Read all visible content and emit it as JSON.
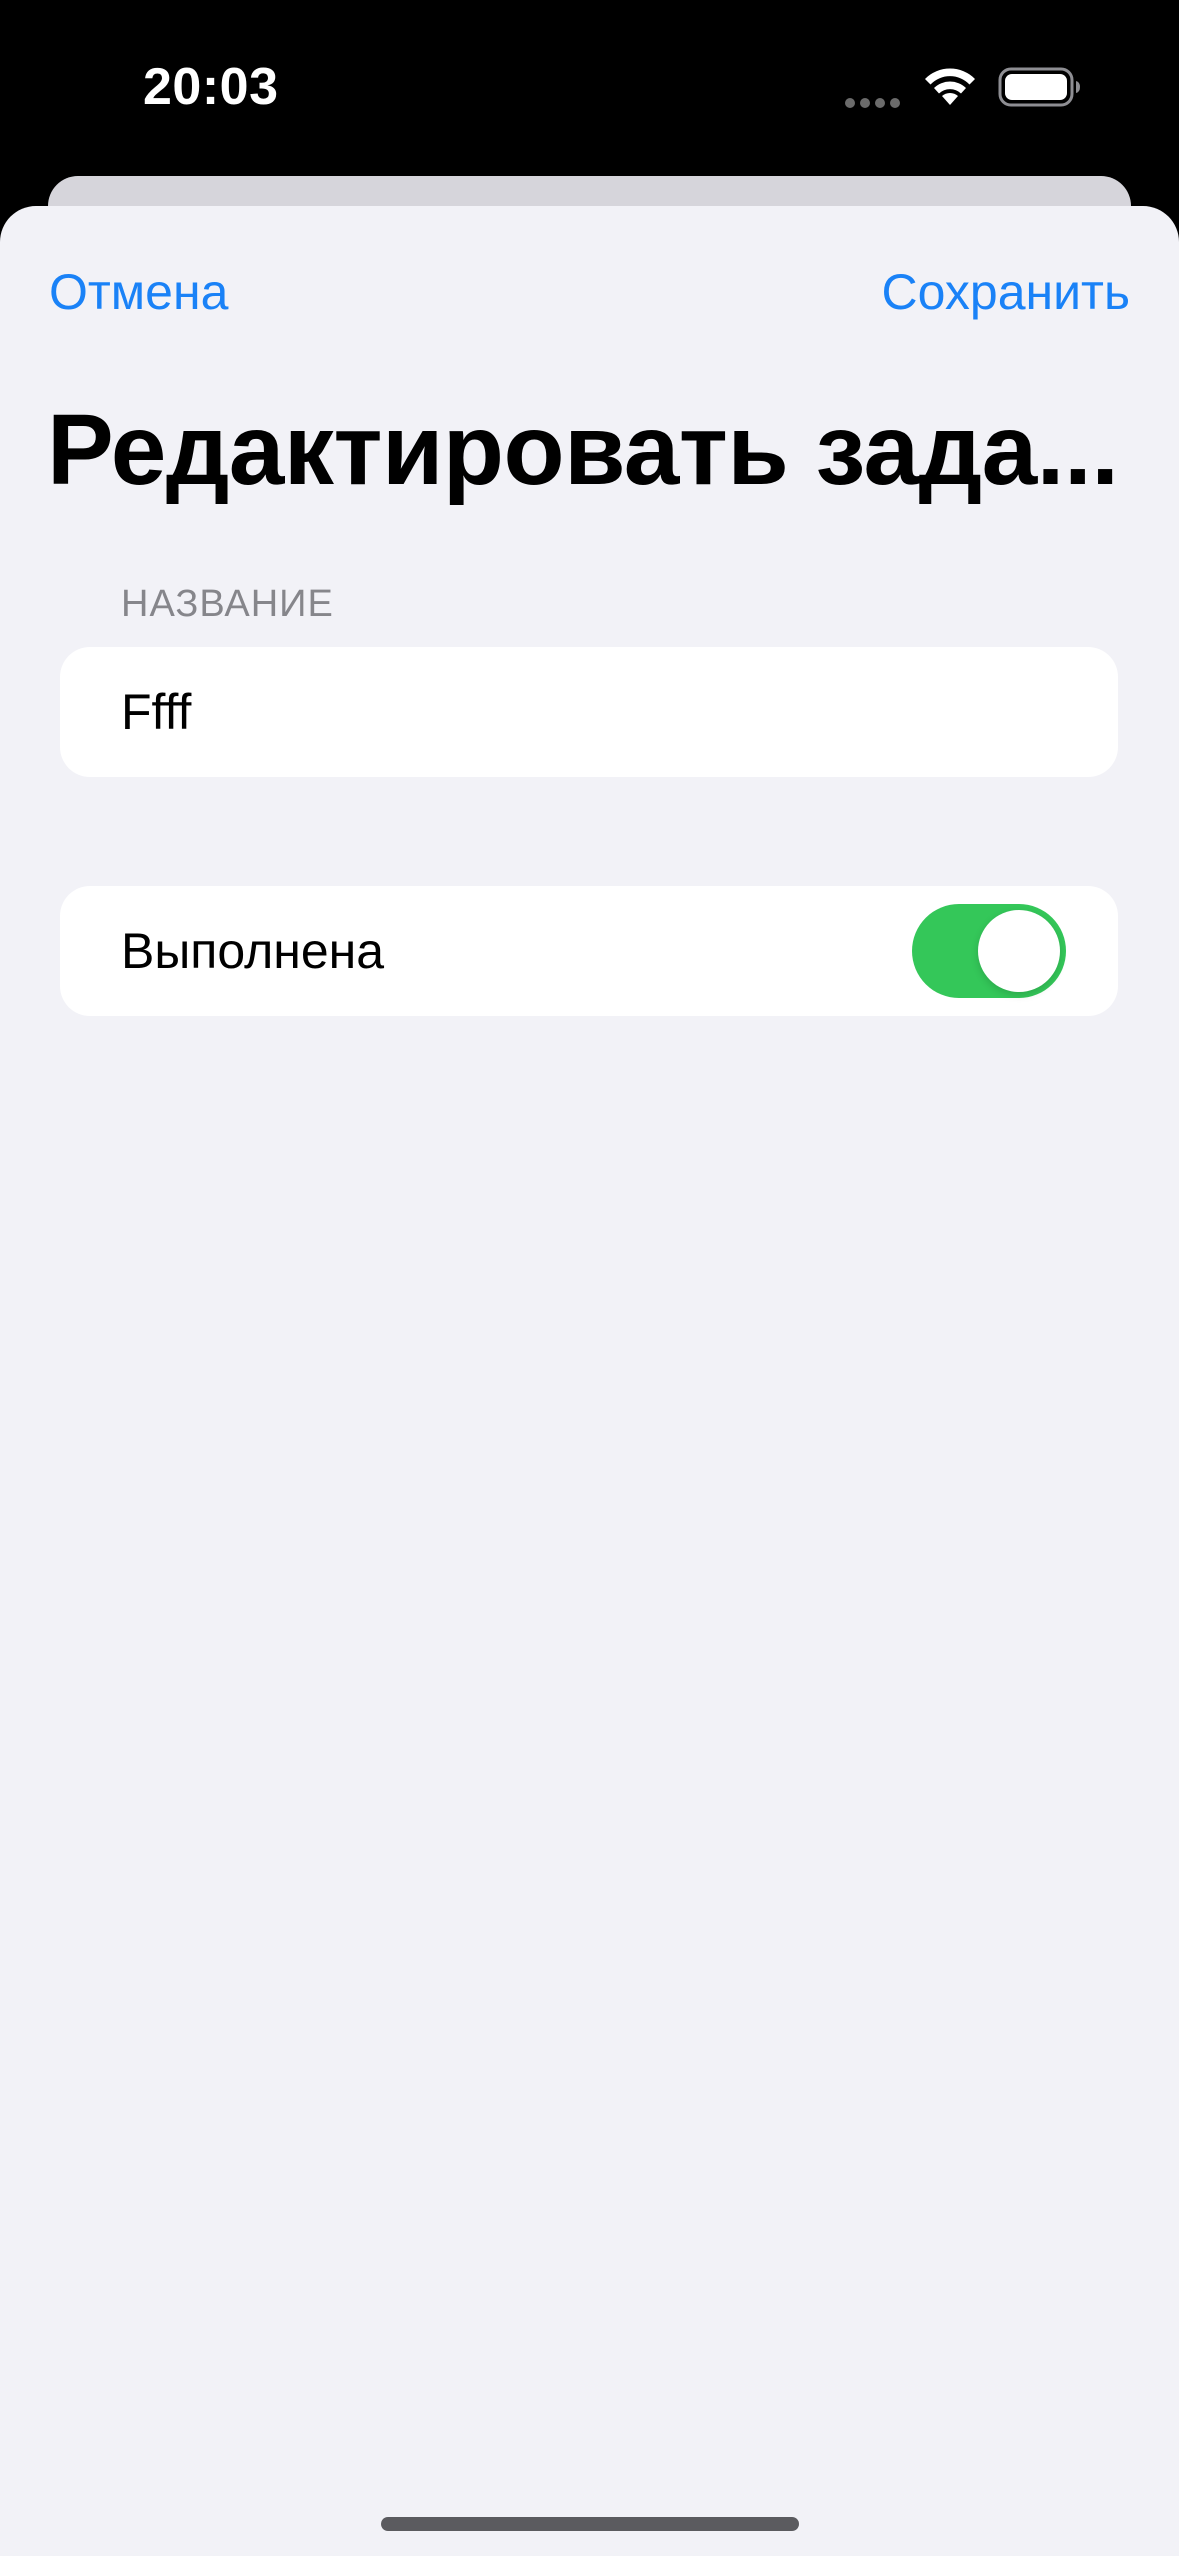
{
  "status_bar": {
    "time": "20:03",
    "icons": [
      "signal-dots-icon",
      "wifi-icon",
      "battery-icon"
    ]
  },
  "nav": {
    "cancel_label": "Отмена",
    "save_label": "Сохранить"
  },
  "title": "Редактировать зада...",
  "name_section": {
    "header": "НАЗВАНИЕ",
    "value": "Ffff"
  },
  "completed_toggle": {
    "label": "Выполнена",
    "on": true
  },
  "colors": {
    "accent": "#1a82f7",
    "toggle_on": "#34c759",
    "background": "#f2f2f7",
    "card": "#ffffff",
    "secondary_text": "#86868b"
  }
}
